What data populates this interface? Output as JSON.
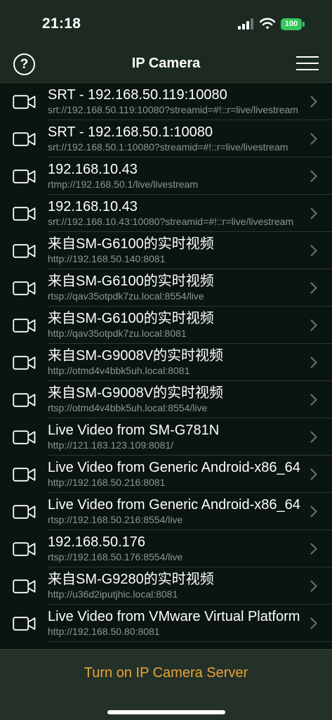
{
  "status": {
    "time": "21:18",
    "battery": "100"
  },
  "nav": {
    "help": "?",
    "title": "IP Camera"
  },
  "cameras": [
    {
      "title": "SRT - 192.168.50.119:10080",
      "url": "srt://192.168.50.119:10080?streamid=#!::r=live/livestream"
    },
    {
      "title": "SRT - 192.168.50.1:10080",
      "url": "srt://192.168.50.1:10080?streamid=#!::r=live/livestream"
    },
    {
      "title": "192.168.10.43",
      "url": "rtmp://192.168.50.1/live/livestream"
    },
    {
      "title": "192.168.10.43",
      "url": "srt://192.168.10.43:10080?streamid=#!::r=live/livestream"
    },
    {
      "title": "来自SM-G6100的实时视频",
      "url": "http://192.168.50.140:8081"
    },
    {
      "title": "来自SM-G6100的实时视频",
      "url": "rtsp://qav35otpdk7zu.local:8554/live"
    },
    {
      "title": "来自SM-G6100的实时视频",
      "url": "http://qav35otpdk7zu.local:8081"
    },
    {
      "title": "来自SM-G9008V的实时视频",
      "url": "http://otmd4v4bbk5uh.local:8081"
    },
    {
      "title": "来自SM-G9008V的实时视频",
      "url": "rtsp://otmd4v4bbk5uh.local:8554/live"
    },
    {
      "title": "Live Video from SM-G781N",
      "url": "http://121.183.123.109:8081/"
    },
    {
      "title": "Live Video from Generic Android-x86_64",
      "url": "http://192.168.50.216:8081"
    },
    {
      "title": "Live Video from Generic Android-x86_64",
      "url": "rtsp://192.168.50.216:8554/live"
    },
    {
      "title": "192.168.50.176",
      "url": "rtsp://192.168.50.176:8554/live"
    },
    {
      "title": "来自SM-G9280的实时视频",
      "url": "http://u36d2iputjhic.local:8081"
    },
    {
      "title": "Live Video from VMware Virtual Platform",
      "url": "http://192.168.50.80:8081"
    }
  ],
  "bottom": {
    "server_button": "Turn on IP Camera Server"
  },
  "colors": {
    "accent": "#e8a53a",
    "battery": "#34c759",
    "background": "#0b1510"
  }
}
